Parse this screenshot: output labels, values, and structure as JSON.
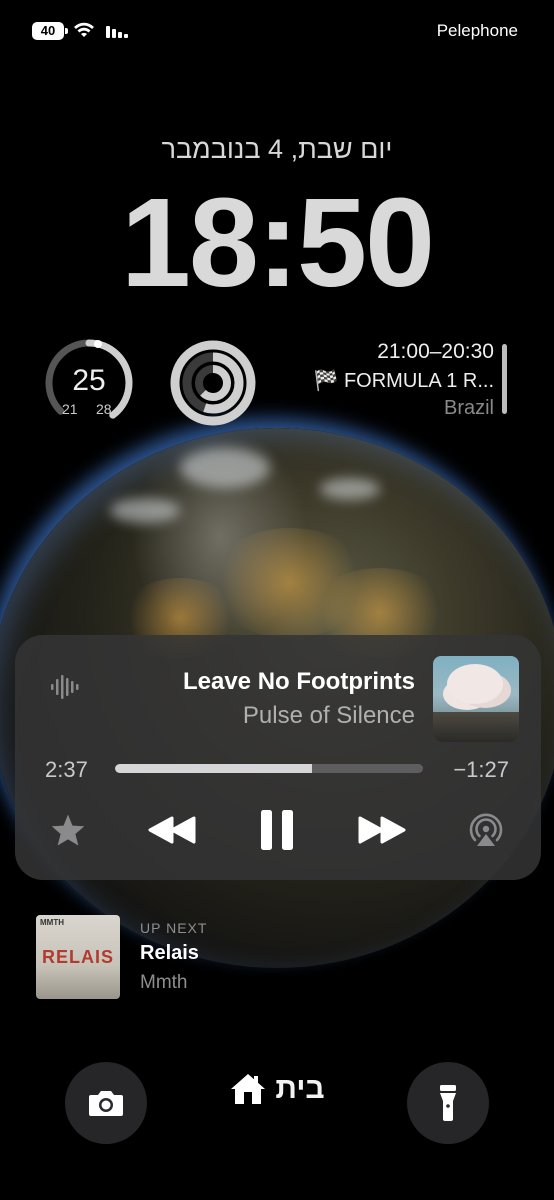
{
  "status_bar": {
    "battery": "40",
    "carrier": "Pelephone"
  },
  "lock_screen": {
    "date": "יום שבת, 4 בנובמבר",
    "time": "18:50"
  },
  "widgets": {
    "weather_ring": {
      "current": "25",
      "low": "21",
      "high": "28"
    },
    "calendar": {
      "time_range": "21:00–20:30",
      "event": "FORMULA 1 R...",
      "event_flag": "🏁",
      "location": "Brazil"
    }
  },
  "now_playing": {
    "title": "Leave No Footprints",
    "artist": "Pulse of Silence",
    "elapsed": "2:37",
    "remaining": "−1:27",
    "progress": 0.64
  },
  "up_next": {
    "label": "UP NEXT",
    "title": "Relais",
    "artist": "Mmth",
    "art_word": "RELAIS",
    "art_mini": "MMTH"
  },
  "bottom": {
    "focus_label": "בית"
  }
}
